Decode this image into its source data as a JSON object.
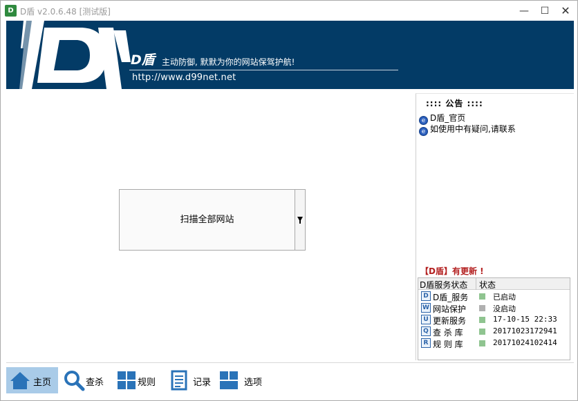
{
  "window": {
    "title": "D盾 v2.0.6.48 [测试版]",
    "icon_text": "D",
    "min_glyph": "—",
    "max_glyph": "☐",
    "close_glyph": "✕"
  },
  "banner": {
    "brand": "D盾",
    "slogan": "主动防御, 默默为你的网站保驾护航!",
    "url": "http://www.d99net.net",
    "background_color": "#033b66"
  },
  "main": {
    "scan_button_label": "扫描全部网站"
  },
  "notice": {
    "heading": ":::: 公告 ::::",
    "items": [
      {
        "label": "D盾_官页",
        "icon": "ie-icon"
      },
      {
        "label": "如使用中有疑问,请联系",
        "icon": "ie-icon"
      }
    ]
  },
  "update_note": "【D盾】有更新 !",
  "services": {
    "columns": [
      "D盾服务状态",
      "状态"
    ],
    "rows": [
      {
        "icon_glyph": "D",
        "name": "D盾_服务",
        "status": "已启动",
        "led_color": "#8fc490"
      },
      {
        "icon_glyph": "W",
        "name": "网站保护",
        "status": "没启动",
        "led_color": "#b0b0b0"
      },
      {
        "icon_glyph": "U",
        "name": "更新服务",
        "status": "17-10-15 22:33",
        "led_color": "#8fc490"
      },
      {
        "icon_glyph": "Q",
        "name": "查 杀 库",
        "status": "20171023172941",
        "led_color": "#8fc490"
      },
      {
        "icon_glyph": "R",
        "name": "规 则 库",
        "status": "20171024102414",
        "led_color": "#8fc490"
      }
    ]
  },
  "toolbar": {
    "items": [
      {
        "label": "主页",
        "icon": "home-icon",
        "active": true
      },
      {
        "label": "查杀",
        "icon": "magnifier-icon",
        "active": false
      },
      {
        "label": "规则",
        "icon": "grid-icon",
        "active": false
      },
      {
        "label": "记录",
        "icon": "log-icon",
        "active": false
      },
      {
        "label": "选项",
        "icon": "options-icon",
        "active": false
      }
    ],
    "accent_color": "#2a73b8",
    "active_bg": "#a9cbe8"
  }
}
